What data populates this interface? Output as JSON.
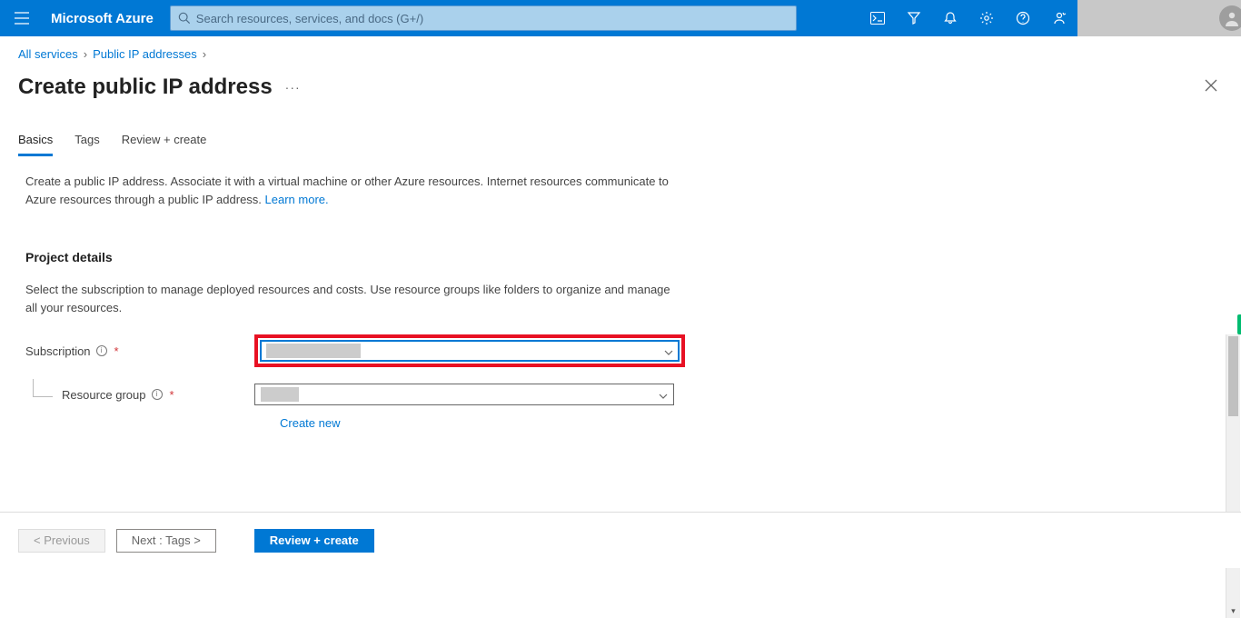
{
  "header": {
    "brand": "Microsoft Azure",
    "search_placeholder": "Search resources, services, and docs (G+/)"
  },
  "breadcrumb": {
    "items": [
      "All services",
      "Public IP addresses"
    ]
  },
  "page": {
    "title": "Create public IP address"
  },
  "tabs": {
    "basics": "Basics",
    "tags": "Tags",
    "review": "Review + create"
  },
  "intro": {
    "text": "Create a public IP address. Associate it with a virtual machine or other Azure resources. Internet resources communicate to Azure resources through a public IP address. ",
    "learn_more": "Learn more."
  },
  "project": {
    "heading": "Project details",
    "desc": "Select the subscription to manage deployed resources and costs. Use resource groups like folders to organize and manage all your resources.",
    "subscription_label": "Subscription",
    "subscription_value": "",
    "resource_group_label": "Resource group",
    "resource_group_value": "",
    "create_new": "Create new"
  },
  "footer": {
    "previous": "< Previous",
    "next": "Next : Tags >",
    "review": "Review + create"
  }
}
